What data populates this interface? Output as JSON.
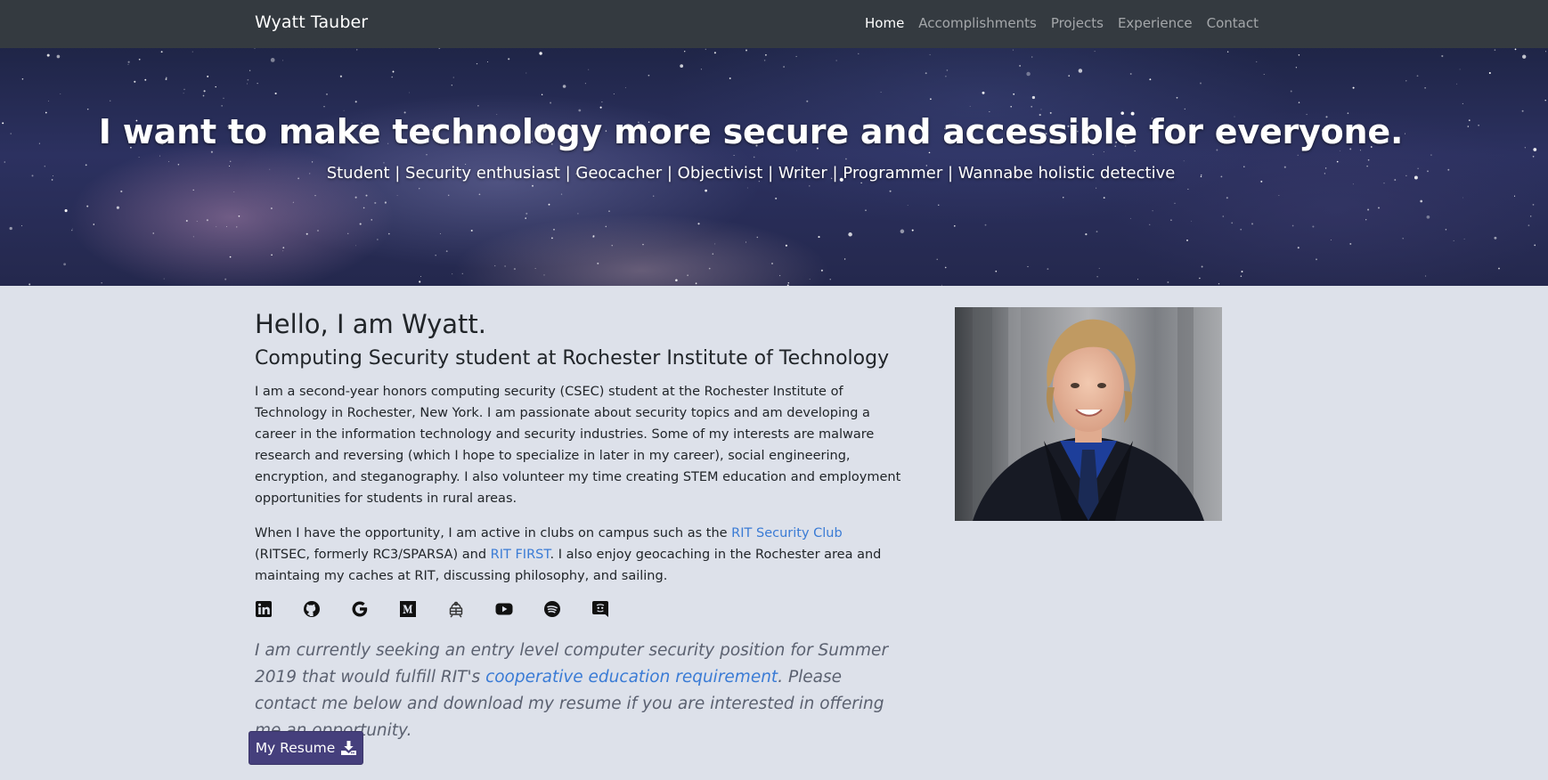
{
  "navbar": {
    "brand": "Wyatt Tauber",
    "links": [
      {
        "label": "Home",
        "active": true
      },
      {
        "label": "Accomplishments",
        "active": false
      },
      {
        "label": "Projects",
        "active": false
      },
      {
        "label": "Experience",
        "active": false
      },
      {
        "label": "Contact",
        "active": false
      }
    ]
  },
  "hero": {
    "title": "I want to make technology more secure and accessible for everyone.",
    "subtitle": "Student | Security enthusiast | Geocacher | Objectivist | Writer | Programmer | Wannabe holistic detective"
  },
  "intro": {
    "greeting": "Hello, I am Wyatt.",
    "headline": "Computing Security student at Rochester Institute of Technology",
    "paragraph1": "I am a second-year honors computing security (CSEC) student at the Rochester Institute of Technology in Rochester, New York. I am passionate about security topics and am developing a career in the information technology and security industries. Some of my interests are malware research and reversing (which I hope to specialize in later in my career), social engineering, encryption, and steganography. I also volunteer my time creating STEM education and employment opportunities for students in rural areas.",
    "paragraph2": {
      "before_link1": "When I have the opportunity, I am active in clubs on campus such as the ",
      "link1": "RIT Security Club",
      "between_links": " (RITSEC, formerly RC3/SPARSA) and ",
      "link2": "RIT FIRST",
      "after_link2": ". I also enjoy geocaching in the Rochester area and maintaing my caches at RIT, discussing philosophy, and sailing."
    }
  },
  "socials": [
    {
      "name": "linkedin",
      "icon": "linkedin-icon"
    },
    {
      "name": "github",
      "icon": "github-icon"
    },
    {
      "name": "google",
      "icon": "google-icon"
    },
    {
      "name": "medium",
      "icon": "medium-icon"
    },
    {
      "name": "geocaching",
      "icon": "geocaching-icon"
    },
    {
      "name": "youtube",
      "icon": "youtube-icon"
    },
    {
      "name": "spotify",
      "icon": "spotify-icon"
    },
    {
      "name": "discord",
      "icon": "discord-icon"
    }
  ],
  "lead": {
    "before_link": "I am currently seeking an entry level computer security position for Summer 2019 that would fulfill RIT's ",
    "link": "cooperative education requirement",
    "after_link": ". Please contact me below and download my resume if you are interested in offering me an opportunity."
  },
  "resume_button": {
    "label": "My Resume",
    "icon": "download-icon"
  },
  "colors": {
    "navbar": "#343a40",
    "page_background": "#dde1ea",
    "link": "#3a7bd5",
    "button": "#453f7c"
  }
}
